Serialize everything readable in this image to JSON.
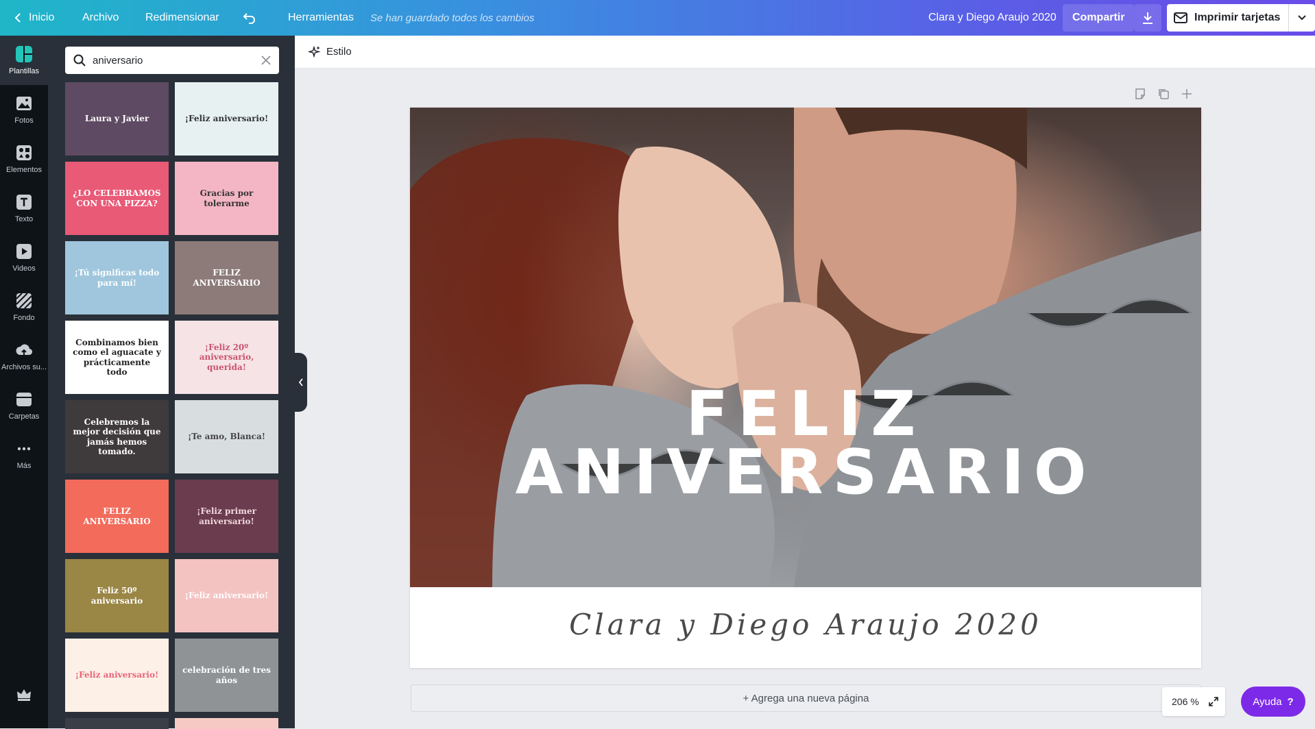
{
  "topbar": {
    "home": "Inicio",
    "file": "Archivo",
    "resize": "Redimensionar",
    "tools": "Herramientas",
    "save_status": "Se han guardado todos los cambios",
    "design_title": "Clara y Diego Araujo 2020",
    "share": "Compartir",
    "print": "Imprimir tarjetas"
  },
  "rail": {
    "items": [
      {
        "label": "Plantillas",
        "icon": "templates-icon"
      },
      {
        "label": "Fotos",
        "icon": "photos-icon"
      },
      {
        "label": "Elementos",
        "icon": "elements-icon"
      },
      {
        "label": "Texto",
        "icon": "text-icon"
      },
      {
        "label": "Videos",
        "icon": "videos-icon"
      },
      {
        "label": "Fondo",
        "icon": "background-icon"
      },
      {
        "label": "Archivos su...",
        "icon": "uploads-icon"
      },
      {
        "label": "Carpetas",
        "icon": "folders-icon"
      },
      {
        "label": "Más",
        "icon": "more-icon"
      }
    ]
  },
  "panel": {
    "search_query": "aniversario",
    "templates": [
      {
        "text": "Laura y Javier",
        "bg": "#5e4a63",
        "fg": "#ffffff"
      },
      {
        "text": "¡Feliz aniversario!",
        "bg": "#e7f1f2",
        "fg": "#333333"
      },
      {
        "text": "¿LO CELEBRAMOS CON UNA PIZZA?",
        "bg": "#e95a77",
        "fg": "#ffffff"
      },
      {
        "text": "Gracias por tolerarme",
        "bg": "#f4b6c5",
        "fg": "#333333"
      },
      {
        "text": "¡Tú significas todo para mí!",
        "bg": "#9fc6dd",
        "fg": "#ffffff"
      },
      {
        "text": "FELIZ ANIVERSARIO",
        "bg": "#8c7b78",
        "fg": "#ffffff"
      },
      {
        "text": "Combinamos bien como el aguacate y prácticamente todo",
        "bg": "#ffffff",
        "fg": "#222222"
      },
      {
        "text": "¡Feliz 20º aniversario, querida!",
        "bg": "#f6e3e6",
        "fg": "#c9546e"
      },
      {
        "text": "Celebremos la mejor decisión que jamás hemos tomado.",
        "bg": "#3f3a3c",
        "fg": "#ffffff"
      },
      {
        "text": "¡Te amo, Blanca!",
        "bg": "#d8dde0",
        "fg": "#444444"
      },
      {
        "text": "FELIZ ANIVERSARIO",
        "bg": "#f26b5b",
        "fg": "#ffffff"
      },
      {
        "text": "¡Feliz primer aniversario!",
        "bg": "#6a3c4d",
        "fg": "#f2d8de"
      },
      {
        "text": "Feliz 50º aniversario",
        "bg": "#9a8645",
        "fg": "#ffffff"
      },
      {
        "text": "¡Feliz aniversario!",
        "bg": "#f3c3c1",
        "fg": "#ffffff"
      },
      {
        "text": "¡Feliz aniversario!",
        "bg": "#fdf0e6",
        "fg": "#e8657b"
      },
      {
        "text": "celebración de tres años",
        "bg": "#8f9396",
        "fg": "#ffffff"
      }
    ]
  },
  "toolbar": {
    "style": "Estilo"
  },
  "design": {
    "headline_1": "FELIZ",
    "headline_2": "ANIVERSARIO",
    "subtitle": "Clara y Diego Araujo 2020"
  },
  "add_page": "+ Agrega una nueva página",
  "zoom": "206 %",
  "help": "Ayuda",
  "help_mark": "?"
}
